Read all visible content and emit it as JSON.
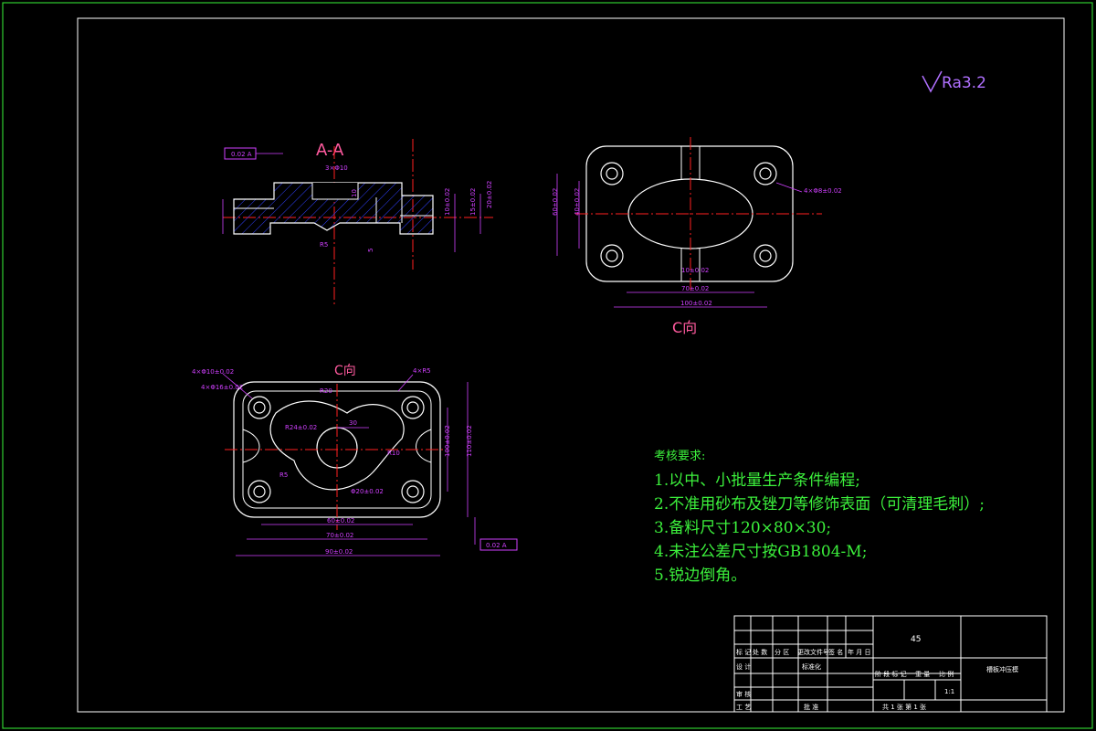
{
  "roughness": "Ra3.2",
  "section_label": "A-A",
  "view_c_label": "C向",
  "view_c_label_small": "C向",
  "requirements": {
    "title": "考核要求:",
    "items": [
      "1.以中、小批量生产条件编程;",
      "2.不准用砂布及锉刀等修饰表面（可清理毛刺）;",
      "3.备料尺寸120×80×30;",
      "4.未注公差尺寸按GB1804-M;",
      "5.锐边倒角。"
    ]
  },
  "title_block": {
    "material": "45",
    "part_name": "槽板冲压模",
    "scale_label": "比 例",
    "scale": "1:1",
    "sheet_info": "共 1 张  第 1 张",
    "rows": [
      "标 记",
      "处 数",
      "分 区",
      "更改文件号",
      "签 名",
      "年 月 日"
    ],
    "design": "设 计",
    "standardize": "标准化",
    "review": "审 核",
    "process": "工 艺",
    "approve": "批 准",
    "stage": "阶 段 标 记",
    "weight": "重 量"
  },
  "dims": {
    "a1": "3×Φ10",
    "a2": "10",
    "a3": "10",
    "a4": "5",
    "a5": "10±0.02",
    "a6": "15±0.02",
    "a7": "20±0.02",
    "a8": "5",
    "a9": "R5",
    "a10": "0.02 A",
    "c1": "4×Φ8±0.02",
    "c2": "40±0.02",
    "c3": "60±0.02",
    "c4": "10±0.02",
    "c5": "70±0.02",
    "c6": "100±0.02",
    "b1": "4×Φ10±0.02",
    "b2": "4×Φ16±0.02",
    "b3": "4×R5",
    "b4": "R20",
    "b5": "30",
    "b6": "R24±0.02",
    "b7": "R10",
    "b8": "R5",
    "b9": "Φ20±0.02",
    "b10": "60±0.02",
    "b11": "70±0.02",
    "b12": "90±0.02",
    "b13": "100±0.02",
    "b14": "110±0.02",
    "b15": "0.02 A"
  }
}
